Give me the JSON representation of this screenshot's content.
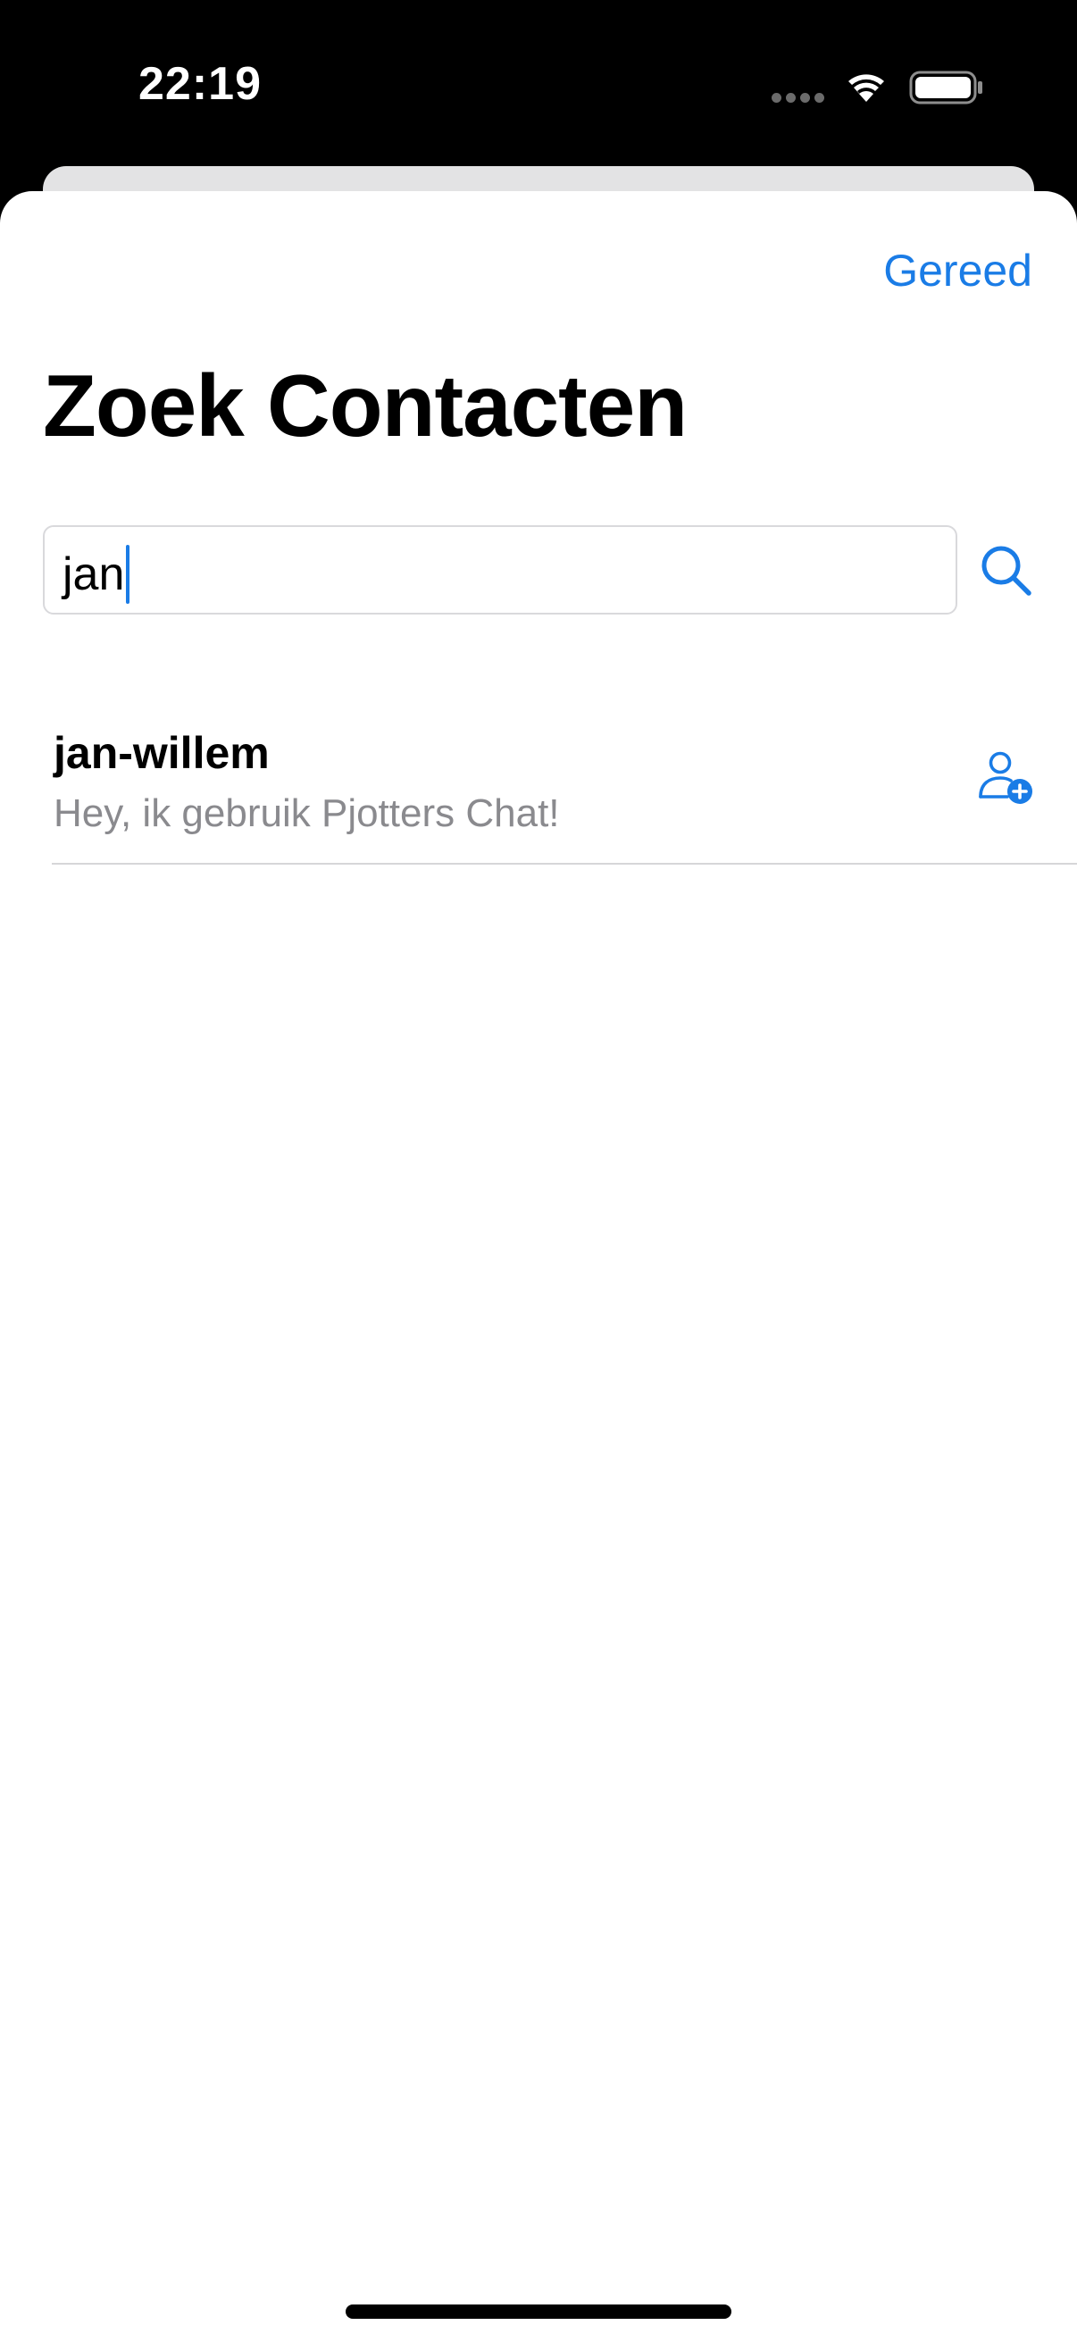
{
  "status_bar": {
    "time": "22:19",
    "icons": [
      "signal-dots-icon",
      "wifi-icon",
      "battery-icon"
    ]
  },
  "header": {
    "done_label": "Gereed",
    "title": "Zoek Contacten"
  },
  "search": {
    "value": "jan",
    "button_icon": "magnifying-glass-icon"
  },
  "results": [
    {
      "name": "jan-willem",
      "status": "Hey, ik gebruik Pjotters Chat!",
      "action_icon": "person-add-icon"
    }
  ],
  "colors": {
    "accent": "#1a7ce6",
    "secondary_text": "#8a8a8e",
    "separator": "#d6d6d8"
  }
}
